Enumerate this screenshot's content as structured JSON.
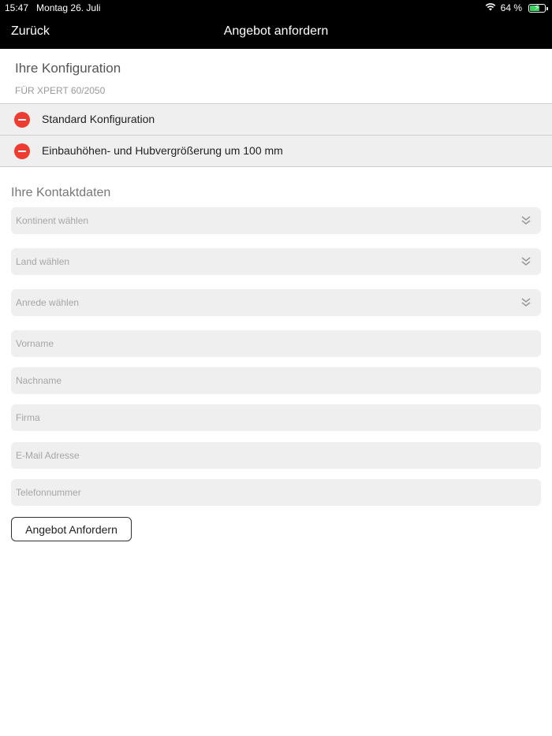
{
  "status": {
    "time": "15:47",
    "date": "Montag 26. Juli",
    "battery": "64 %",
    "battery_level": 0.64,
    "accent_green": "#37d35a"
  },
  "nav": {
    "back_label": "Zurück",
    "title": "Angebot anfordern"
  },
  "config": {
    "heading": "Ihre Konfiguration",
    "subheading": "FÜR XPERT 60/2050",
    "items": [
      {
        "label": "Standard Konfiguration"
      },
      {
        "label": "Einbauhöhen- und Hubvergrößerung um 100 mm"
      }
    ],
    "remove_color": "#f03b30"
  },
  "contact": {
    "heading": "Ihre Kontaktdaten",
    "selects": [
      {
        "placeholder": "Kontinent wählen"
      },
      {
        "placeholder": "Land wählen"
      },
      {
        "placeholder": "Anrede wählen"
      }
    ],
    "inputs": [
      {
        "placeholder": "Vorname"
      },
      {
        "placeholder": "Nachname"
      },
      {
        "placeholder": "Firma"
      },
      {
        "placeholder": "E-Mail Adresse"
      },
      {
        "placeholder": "Telefonnummer"
      }
    ],
    "submit_label": "Angebot Anfordern"
  }
}
